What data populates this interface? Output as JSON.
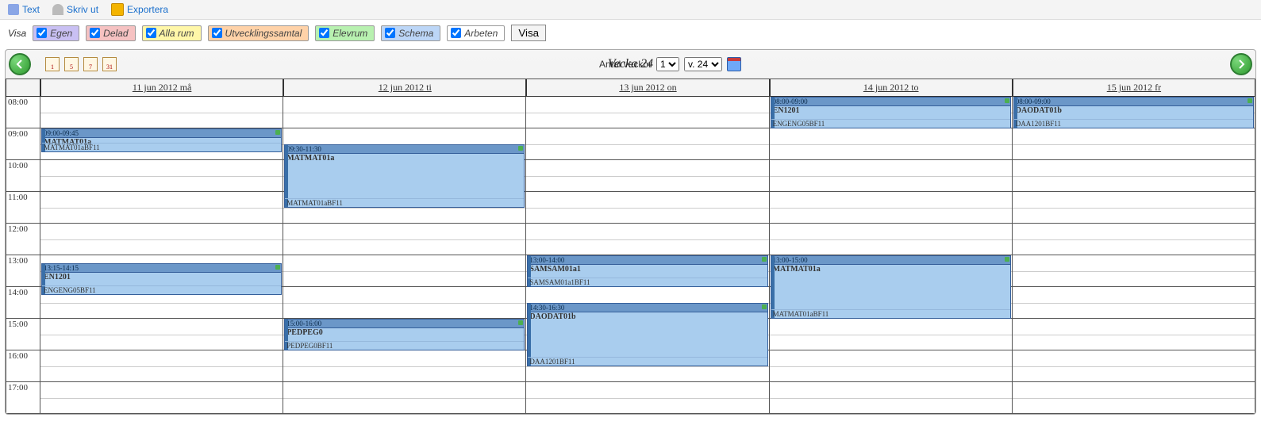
{
  "toolbar": {
    "text": "Text",
    "print": "Skriv ut",
    "export": "Exportera"
  },
  "filter": {
    "lead": "Visa",
    "egen": "Egen",
    "delad": "Delad",
    "allarum": "Alla rum",
    "utv": "Utvecklingssamtal",
    "elevrum": "Elevrum",
    "schema": "Schema",
    "arbeten": "Arbeten",
    "button": "Visa"
  },
  "calendar": {
    "title": "Vecka 24",
    "antal_label": "Antal veckor",
    "antal_value": "1",
    "week_value": "v. 24",
    "mini": [
      "1",
      "5",
      "7",
      "31"
    ],
    "days": [
      "11 jun 2012 må",
      "12 jun 2012 ti",
      "13 jun 2012 on",
      "14 jun 2012 to",
      "15 jun 2012 fr"
    ],
    "hours": [
      "08:00",
      "09:00",
      "10:00",
      "11:00",
      "12:00",
      "13:00",
      "14:00",
      "15:00",
      "16:00",
      "17:00"
    ]
  },
  "events": [
    {
      "day": 0,
      "startH": 9,
      "startM": 0,
      "endH": 9,
      "endM": 45,
      "time": "09:00-09:45",
      "title": "MATMAT01a",
      "foot": "MATMAT01aBF11"
    },
    {
      "day": 0,
      "startH": 13,
      "startM": 15,
      "endH": 14,
      "endM": 15,
      "time": "13:15-14:15",
      "title": "EN1201",
      "foot": "ENGENG05BF11"
    },
    {
      "day": 1,
      "startH": 9,
      "startM": 30,
      "endH": 11,
      "endM": 30,
      "time": "09:30-11:30",
      "title": "MATMAT01a",
      "foot": "MATMAT01aBF11"
    },
    {
      "day": 1,
      "startH": 15,
      "startM": 0,
      "endH": 16,
      "endM": 0,
      "time": "15:00-16:00",
      "title": "PEDPEG0",
      "foot": "PEDPEG0BF11"
    },
    {
      "day": 2,
      "startH": 13,
      "startM": 0,
      "endH": 14,
      "endM": 0,
      "time": "13:00-14:00",
      "title": "SAMSAM01a1",
      "foot": "SAMSAM01a1BF11"
    },
    {
      "day": 2,
      "startH": 14,
      "startM": 30,
      "endH": 16,
      "endM": 30,
      "time": "14:30-16:30",
      "title": "DAODAT01b",
      "foot": "DAA1201BF11"
    },
    {
      "day": 3,
      "startH": 8,
      "startM": 0,
      "endH": 9,
      "endM": 0,
      "time": "08:00-09:00",
      "title": "EN1201",
      "foot": "ENGENG05BF11"
    },
    {
      "day": 3,
      "startH": 13,
      "startM": 0,
      "endH": 15,
      "endM": 0,
      "time": "13:00-15:00",
      "title": "MATMAT01a",
      "foot": "MATMAT01aBF11"
    },
    {
      "day": 4,
      "startH": 8,
      "startM": 0,
      "endH": 9,
      "endM": 0,
      "time": "08:00-09:00",
      "title": "DAODAT01b",
      "foot": "DAA1201BF11"
    }
  ]
}
